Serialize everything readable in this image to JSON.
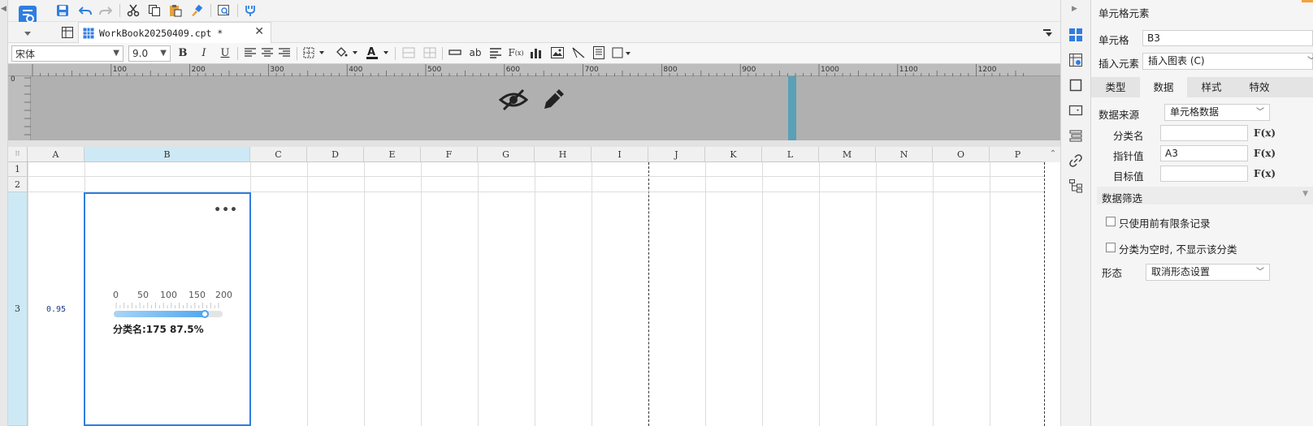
{
  "document": {
    "tab_title": "WorkBook20250409.cpt *",
    "close_glyph": "✕"
  },
  "font_bar": {
    "font_name": "宋体",
    "font_size": "9.0",
    "bold": "B",
    "italic": "I",
    "underline": "U"
  },
  "ruler": {
    "zero": "0",
    "marks": [
      "100",
      "200",
      "300",
      "400",
      "500",
      "600",
      "700",
      "800",
      "900",
      "1000",
      "1100",
      "1200"
    ]
  },
  "grid": {
    "columns": [
      "A",
      "B",
      "C",
      "D",
      "E",
      "F",
      "G",
      "H",
      "I",
      "J",
      "K",
      "L",
      "M",
      "N",
      "O",
      "P"
    ],
    "selected_column": "B",
    "rows": [
      "1",
      "2",
      "3"
    ],
    "selected_row": "3",
    "a3_value": "0.95",
    "more_glyph": "•••"
  },
  "gauge": {
    "ticks": [
      "0",
      "50",
      "100",
      "150",
      "200"
    ],
    "min": 0,
    "max": 200,
    "value": 175,
    "label": "分类名:175 87.5%",
    "fill_color": "#4ea6ee"
  },
  "panel": {
    "title": "单元格元素",
    "cell_label": "单元格",
    "cell_value": "B3",
    "insert_label": "插入元素",
    "insert_value": "插入图表 (C)",
    "tabs": [
      "类型",
      "数据",
      "样式",
      "特效"
    ],
    "active_tab": "数据",
    "source_label": "数据来源",
    "source_value": "单元格数据",
    "category_label": "分类名",
    "category_value": "",
    "pointer_label": "指针值",
    "pointer_value": "A3",
    "target_label": "目标值",
    "target_value": "",
    "fx": "F(x)",
    "filter_label": "数据筛选",
    "check1_label": "只使用前有限条记录",
    "check2_label": "分类为空时, 不显示该分类",
    "form_label": "形态",
    "form_value": "取消形态设置"
  },
  "colors": {
    "accent": "#2f7ee0",
    "selected_header": "#cde9f6",
    "preview_bg": "#b0b0b0"
  }
}
